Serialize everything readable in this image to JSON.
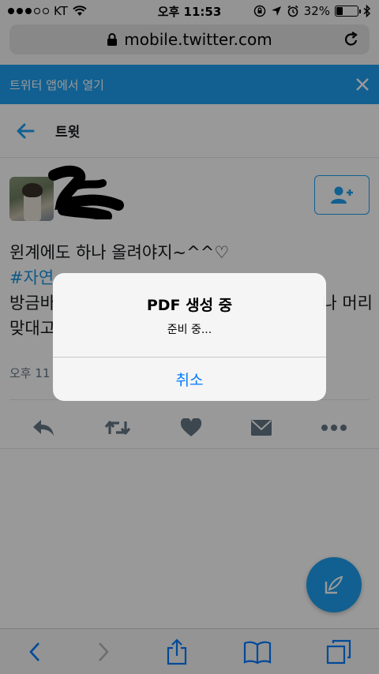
{
  "status_bar": {
    "carrier": "KT",
    "time": "오후 11:53",
    "battery": "32%",
    "battery_level": 0.32
  },
  "browser": {
    "url": "mobile.twitter.com"
  },
  "app_banner": {
    "label": "트위터 앱에서 열기"
  },
  "header": {
    "title": "트윗"
  },
  "tweet": {
    "text_line1": "윈계에도 하나 올려야지~^^♡",
    "hashtag_visible": "#자연",
    "text_line3_start": "방금바",
    "text_line3_end": "나 머리",
    "text_line4_start": "맞대고",
    "time_partial": "오후 11"
  },
  "alert": {
    "title": "PDF 생성 중",
    "message": "준비 중...",
    "cancel_label": "취소"
  },
  "colors": {
    "twitter_blue": "#1da1f2",
    "ios_blue": "#007aff",
    "icon_grey": "#657786"
  }
}
